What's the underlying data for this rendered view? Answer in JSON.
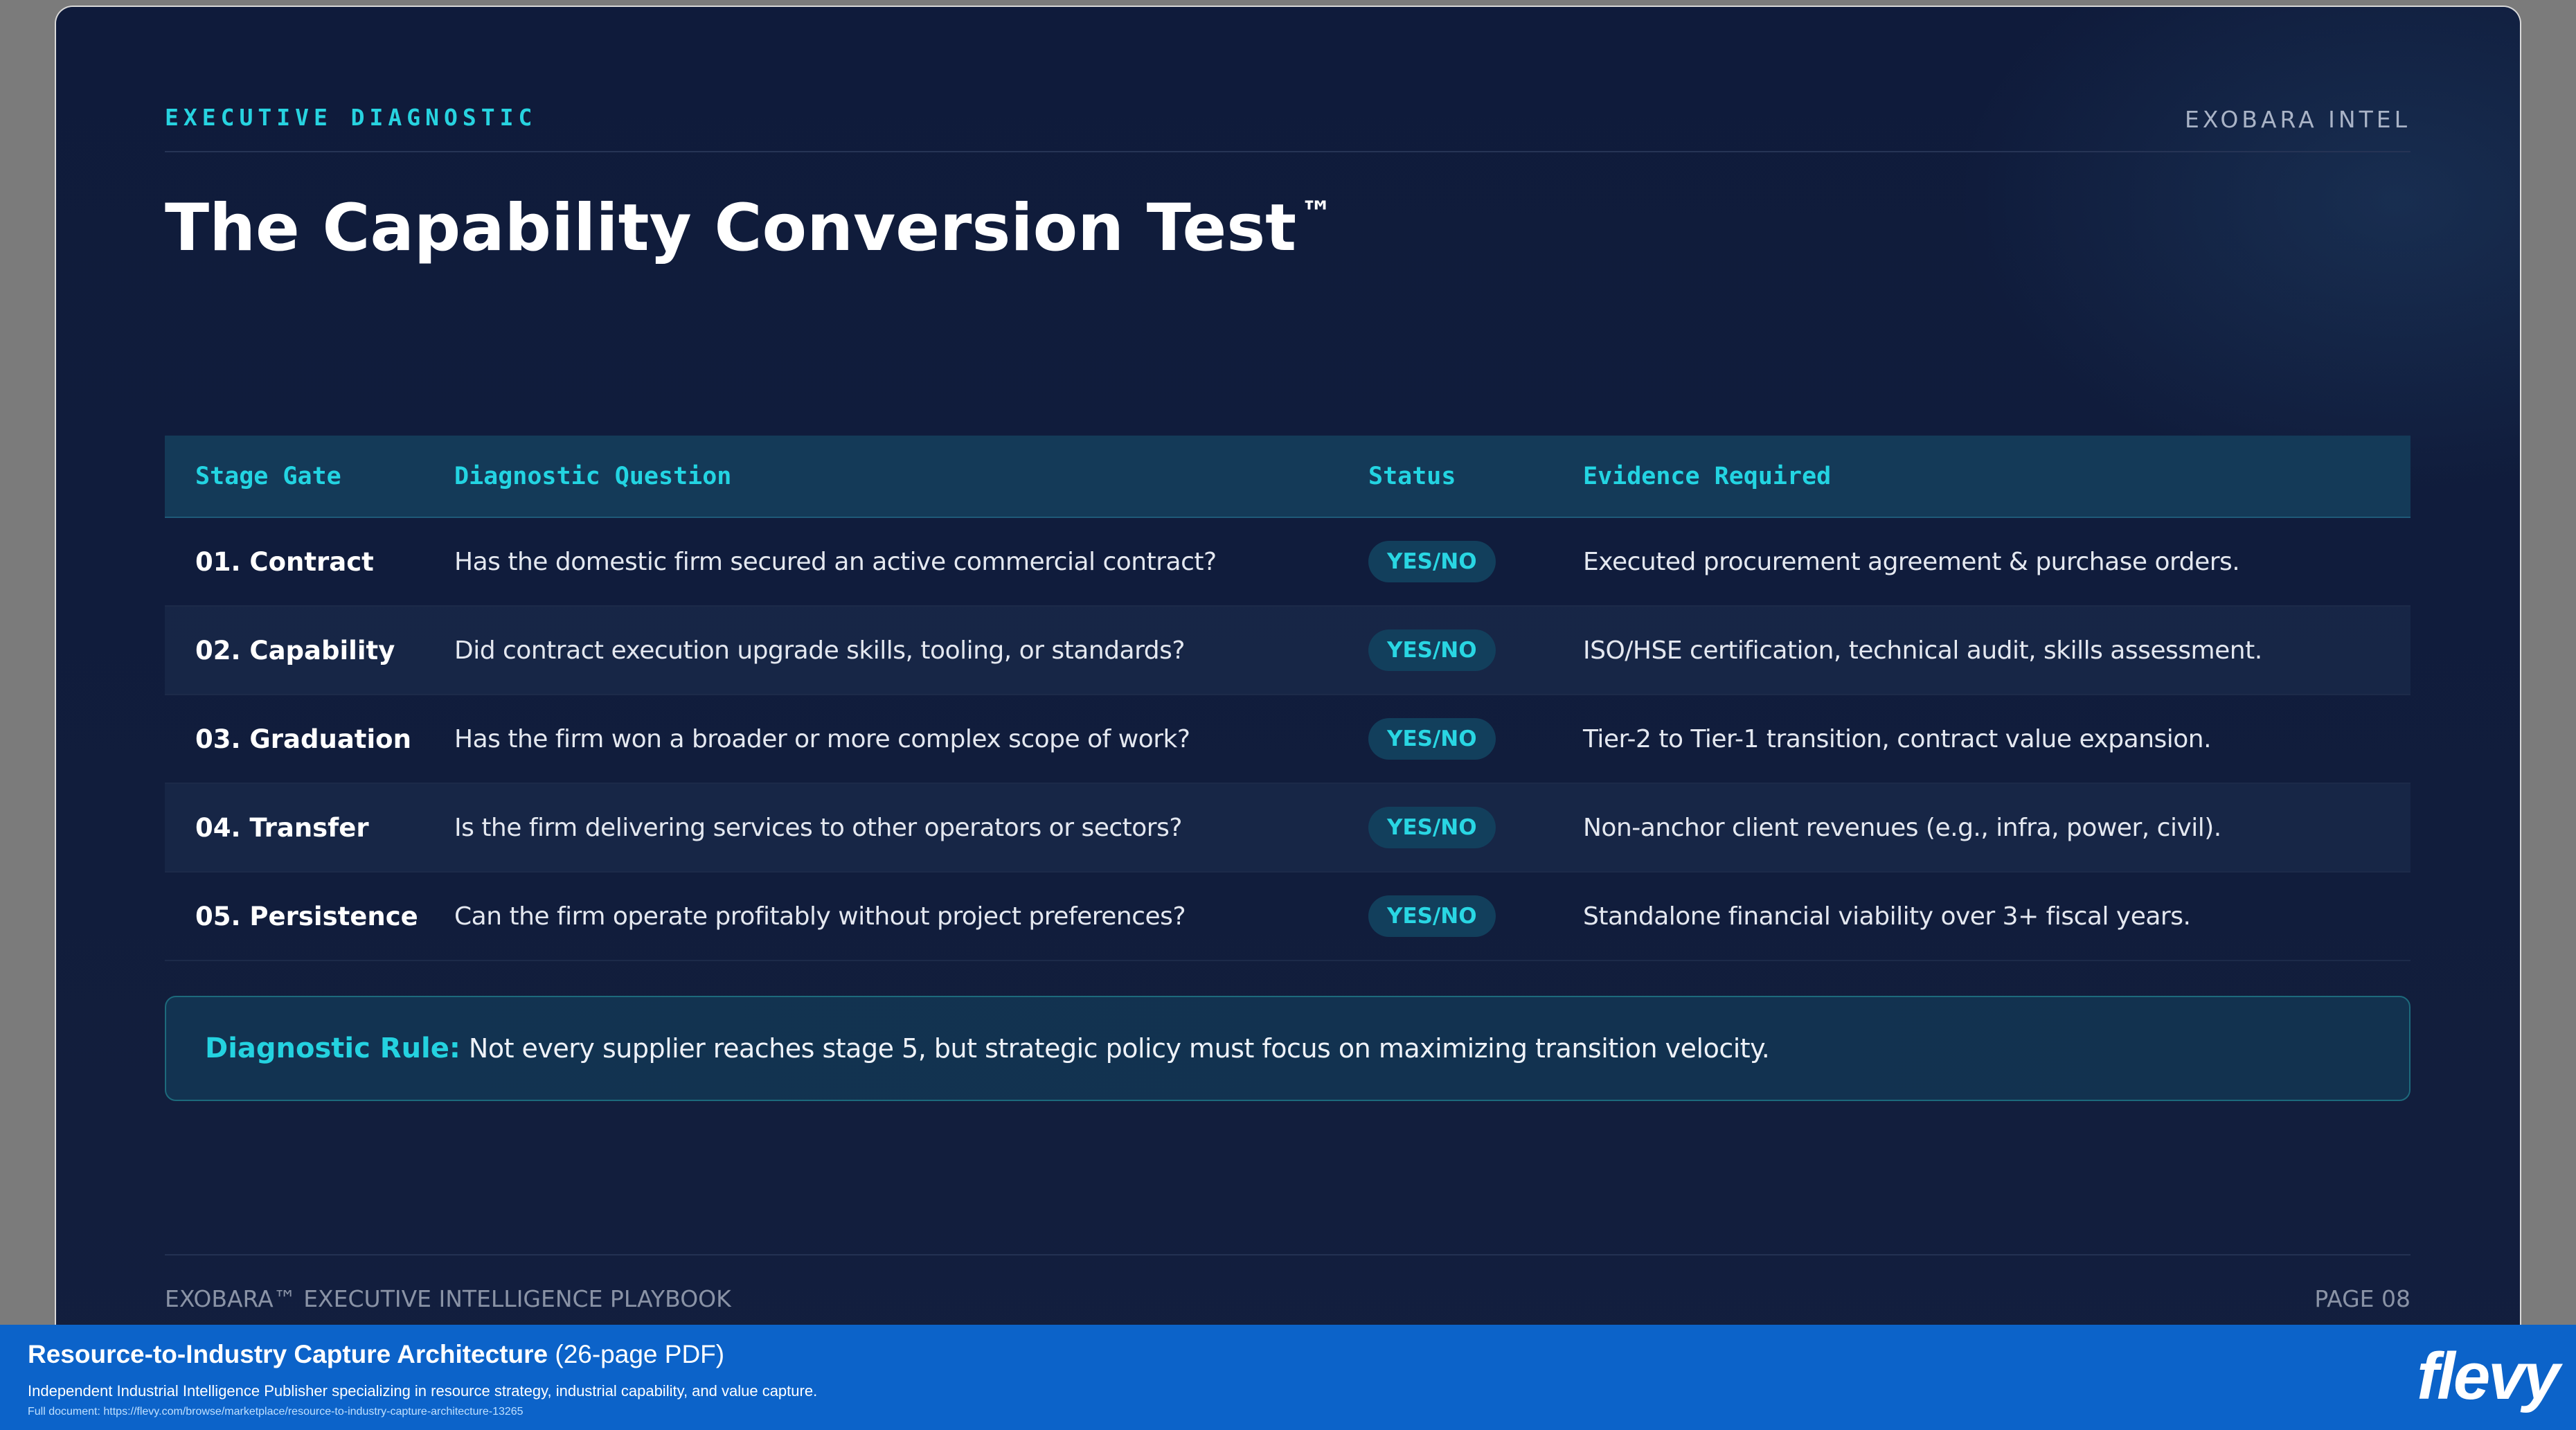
{
  "slide": {
    "kicker": "EXECUTIVE DIAGNOSTIC",
    "brand": "EXOBARA INTEL",
    "title": "The Capability Conversion Test",
    "title_mark": "™"
  },
  "table": {
    "headers": [
      "Stage Gate",
      "Diagnostic Question",
      "Status",
      "Evidence Required"
    ],
    "rows": [
      {
        "stage": "01. Contract",
        "question": "Has the domestic firm secured an active commercial contract?",
        "status": "YES/NO",
        "evidence": "Executed procurement agreement & purchase orders."
      },
      {
        "stage": "02. Capability",
        "question": "Did contract execution upgrade skills, tooling, or standards?",
        "status": "YES/NO",
        "evidence": "ISO/HSE certification, technical audit, skills assessment."
      },
      {
        "stage": "03. Graduation",
        "question": "Has the firm won a broader or more complex scope of work?",
        "status": "YES/NO",
        "evidence": "Tier-2 to Tier-1 transition, contract value expansion."
      },
      {
        "stage": "04. Transfer",
        "question": "Is the firm delivering services to other operators or sectors?",
        "status": "YES/NO",
        "evidence": "Non-anchor client revenues (e.g., infra, power, civil)."
      },
      {
        "stage": "05. Persistence",
        "question": "Can the firm operate profitably without project preferences?",
        "status": "YES/NO",
        "evidence": "Standalone financial viability over 3+ fiscal years."
      }
    ]
  },
  "rule": {
    "label": "Diagnostic Rule:",
    "text": "Not every supplier reaches stage 5, but strategic policy must focus on maximizing transition velocity."
  },
  "footer": {
    "left": "EXOBARA™ EXECUTIVE INTELLIGENCE PLAYBOOK",
    "right": "PAGE 08"
  },
  "banner": {
    "title_bold": "Resource-to-Industry Capture Architecture",
    "title_rest": " (26-page PDF)",
    "subtitle": "Independent Industrial Intelligence Publisher specializing in resource strategy, industrial capability, and value capture.",
    "url": "Full document: https://flevy.com/browse/marketplace/resource-to-industry-capture-architecture-13265",
    "logo": "flevy"
  },
  "colors": {
    "background": "#0f1b3b",
    "accent": "#27d3e0",
    "banner": "#0c63c9"
  }
}
